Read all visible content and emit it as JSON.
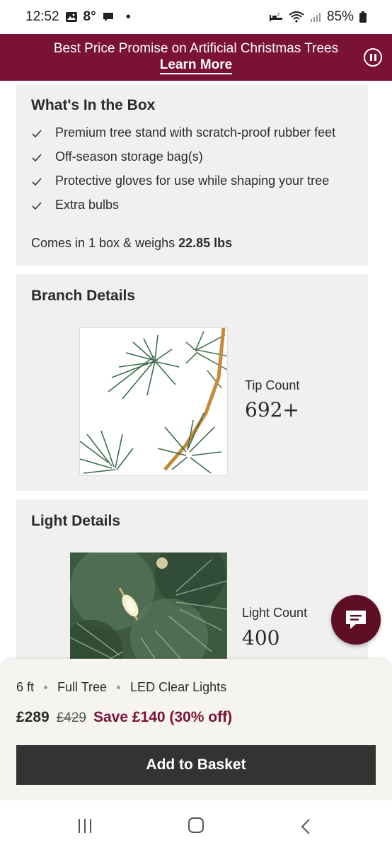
{
  "status_bar": {
    "time": "12:52",
    "temperature": "8°",
    "battery": "85%",
    "icons": [
      "gallery-icon",
      "chat-bubble-icon",
      "notification-dot-icon",
      "sleep-mode-icon",
      "wifi-icon",
      "signal-icon",
      "battery-icon"
    ]
  },
  "promo_banner": {
    "text": "Best Price Promise on Artificial Christmas Trees",
    "link": "Learn More",
    "background": "#7a1238"
  },
  "whats_in_box": {
    "title": "What's In the Box",
    "items": [
      "Premium tree stand with scratch-proof rubber feet",
      "Off-season storage bag(s)",
      "Protective gloves for use while shaping your tree",
      "Extra bulbs"
    ],
    "summary_prefix": "Comes in 1 box & weighs",
    "weight": "22.85 lbs"
  },
  "branch_details": {
    "title": "Branch Details",
    "stat_label": "Tip Count",
    "stat_value": "692+"
  },
  "light_details": {
    "title": "Light Details",
    "stat_label": "Light Count",
    "stat_value": "400"
  },
  "purchase": {
    "options": [
      "6 ft",
      "Full Tree",
      "LED Clear Lights"
    ],
    "price": "£289",
    "was_price": "£429",
    "savings": "Save £140 (30% off)",
    "button_label": "Add to Basket"
  },
  "colors": {
    "accent": "#7a1238",
    "chat_button": "#5e0e24",
    "button_dark": "#333333",
    "card_bg": "#f0f0f0"
  }
}
